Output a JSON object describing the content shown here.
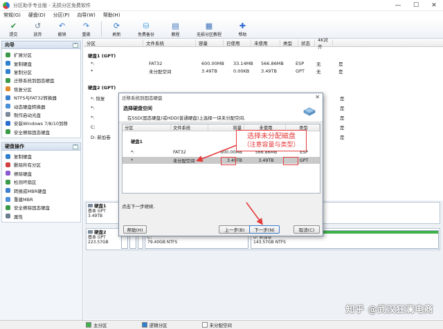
{
  "window": {
    "title": "分区助手专业版 - 无损分区免费软件"
  },
  "menu": [
    "常规(G)",
    "硬盘(D)",
    "分区(P)",
    "向导(W)",
    "帮助(H)"
  ],
  "toolbar": [
    {
      "label": "提交",
      "icon": "check-icon",
      "color": "#2f8f3a"
    },
    {
      "label": "放弃",
      "icon": "discard-icon",
      "color": "#6a7c8f"
    },
    {
      "label": "撤销",
      "icon": "undo-icon",
      "color": "#3a7fd0"
    },
    {
      "label": "重做",
      "icon": "redo-icon",
      "color": "#3a7fd0"
    },
    {
      "label": "刷新",
      "icon": "refresh-icon",
      "color": "#2f78c4"
    },
    {
      "label": "免费备份",
      "icon": "backup-icon",
      "color": "#3d9ad8"
    },
    {
      "label": "教程",
      "icon": "tutorial-icon",
      "color": "#3a6fb8"
    },
    {
      "label": "无损分区教程",
      "icon": "guide-icon",
      "color": "#3a6fb8"
    },
    {
      "label": "帮助",
      "icon": "help-icon",
      "color": "#2e6bd0"
    }
  ],
  "left_panel": {
    "wizard": {
      "title": "向导",
      "items": [
        "扩展分区",
        "复制硬盘",
        "复制分区",
        "迁移系统到固态硬盘",
        "恢复分区",
        "NTFS与FAT32转换器",
        "动态硬盘转换器",
        "制作启动光盘",
        "安装Windows 7/8/10到移",
        "安全擦除固态硬盘"
      ]
    },
    "disk_ops": {
      "title": "硬盘操作",
      "items": [
        "复制硬盘",
        "删除所有分区",
        "擦除硬盘",
        "检测坏扇区",
        "转换成MBR硬盘",
        "重建MBR",
        "安全擦除固态硬盘",
        "属性"
      ]
    }
  },
  "main_grid": {
    "headers": [
      "分区",
      "文件系统",
      "容量",
      "已使用",
      "未使用",
      "类型",
      "状态",
      "4K对齐"
    ],
    "disk1_label": "硬盘1 (GPT)",
    "disk1_rows": [
      [
        "*:",
        "FAT32",
        "600.00MB",
        "33.14MB",
        "566.86MB",
        "ESP",
        "无",
        "是"
      ],
      [
        "*",
        "未分配空间",
        "3.49TB",
        "0.00KB",
        "3.49TB",
        "GPT",
        "无",
        "是"
      ]
    ],
    "disk2_label": "硬盘2 (GPT)",
    "disk2_rows": [
      [
        "*: 恢复",
        "",
        "",
        "",
        "",
        "",
        "",
        "是"
      ],
      [
        "*:",
        "",
        "",
        "",
        "",
        "",
        "",
        "是"
      ],
      [
        "*:",
        "",
        "",
        "",
        "",
        "",
        "",
        "是"
      ],
      [
        "C:",
        "",
        "",
        "",
        "",
        "",
        "",
        "是"
      ],
      [
        "D: 新加卷",
        "",
        "",
        "",
        "",
        "",
        "",
        "是"
      ]
    ]
  },
  "disk_map": {
    "disk1": {
      "name": "硬盘1",
      "style": "基本 GPT",
      "size": "3.49TB"
    },
    "disk2": {
      "name": "硬盘2",
      "style": "基本 GPT",
      "size": "223.57GB",
      "partitions": [
        {
          "label": "C:",
          "detail": "79.40GB NTFS"
        },
        {
          "label": "D: 新加卷",
          "detail": "143.57GB NTFS"
        }
      ]
    }
  },
  "dialog": {
    "title": "迁移系统到固态硬盘",
    "header_title": "选择硬盘空间",
    "header_desc": "在SSD(固态硬盘)或HDD(普通硬盘)上选择一块未分配空间.",
    "headers": [
      "分区",
      "文件系统",
      "容量",
      "未使用",
      "类型"
    ],
    "group": "硬盘1",
    "rows": [
      [
        "*:",
        "FAT32",
        "600.00MB",
        "566.86MB",
        "ESP"
      ],
      [
        "*",
        "未分配空间",
        "3.49TB",
        "3.49TB",
        "GPT"
      ]
    ],
    "hint": "点击下一步继续.",
    "buttons": {
      "help": "帮助(H)",
      "prev": "上一步(B)",
      "next": "下一步(N)",
      "cancel": "取消(C)"
    }
  },
  "annotation": {
    "line1": "选择未分配磁盘",
    "line2": "（注意容量与类型）",
    "color": "#e53a3a"
  },
  "statusbar": {
    "primary": "主分区",
    "logical": "逻辑分区",
    "unallocated": "未分配空间"
  },
  "watermark": "知乎 @武汉狂澜电商"
}
